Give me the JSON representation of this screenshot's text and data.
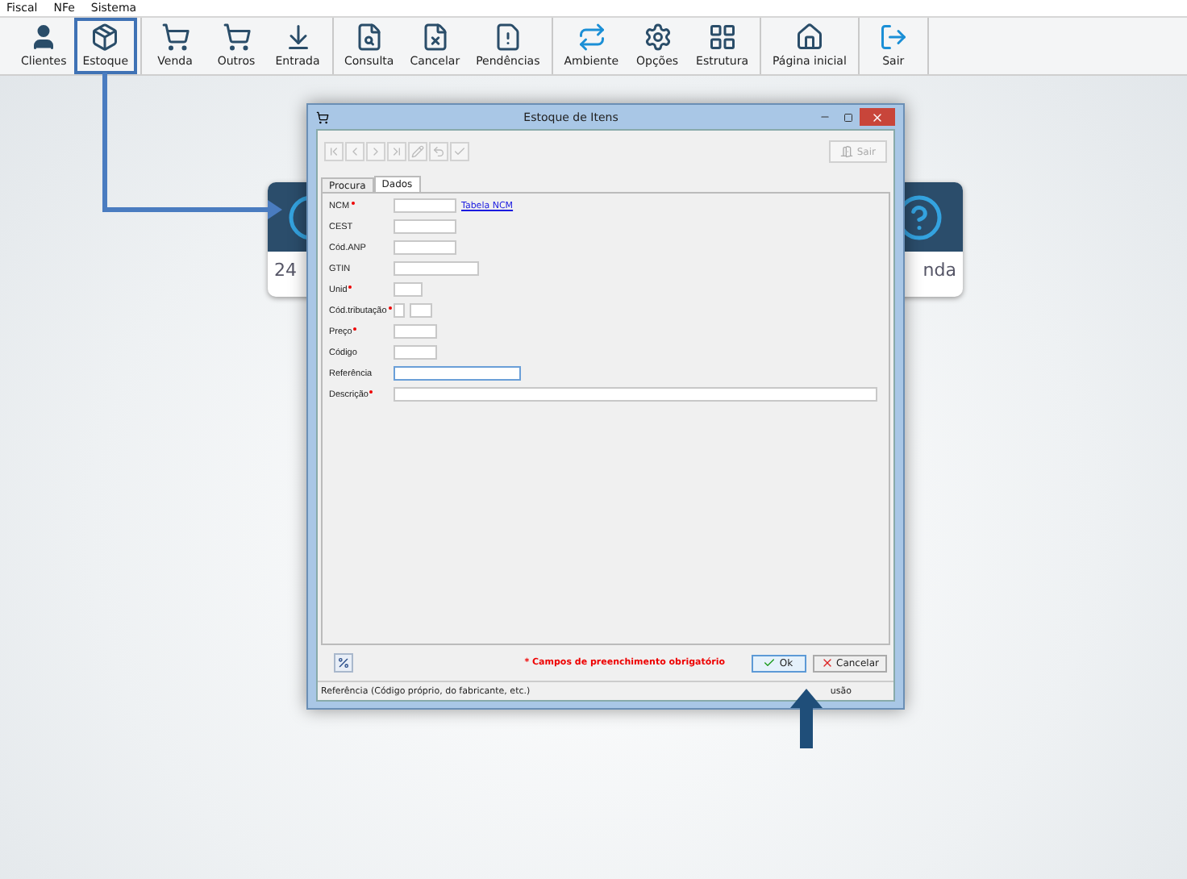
{
  "menu": [
    "Fiscal",
    "NFe",
    "Sistema"
  ],
  "toolbar": [
    {
      "items": [
        {
          "kind": "person",
          "label": "Clientes",
          "highlighted": false
        },
        {
          "kind": "box",
          "label": "Estoque",
          "highlighted": true
        }
      ]
    },
    {
      "items": [
        {
          "kind": "cart-plus",
          "label": "Venda",
          "highlighted": false
        },
        {
          "kind": "cart",
          "label": "Outros",
          "highlighted": false
        },
        {
          "kind": "download",
          "label": "Entrada",
          "highlighted": false
        }
      ]
    },
    {
      "items": [
        {
          "kind": "doc-search",
          "label": "Consulta",
          "highlighted": false
        },
        {
          "kind": "doc-x",
          "label": "Cancelar",
          "highlighted": false
        },
        {
          "kind": "doc-warn",
          "label": "Pendências",
          "highlighted": false
        }
      ]
    },
    {
      "items": [
        {
          "kind": "repeat",
          "label": "Ambiente",
          "highlighted": false
        },
        {
          "kind": "gears",
          "label": "Opções",
          "highlighted": false
        },
        {
          "kind": "grid",
          "label": "Estrutura",
          "highlighted": false
        }
      ]
    },
    {
      "items": [
        {
          "kind": "home",
          "label": "Página inicial",
          "highlighted": false
        }
      ]
    },
    {
      "items": [
        {
          "kind": "exit",
          "label": "Sair",
          "highlighted": false
        }
      ]
    }
  ],
  "background_cards": [
    {
      "text": "24"
    },
    {
      "text": "nda"
    }
  ],
  "dialog": {
    "title": "Estoque de Itens",
    "nav_buttons": [
      {
        "kind": "first",
        "disabled": true
      },
      {
        "kind": "prev",
        "disabled": true
      },
      {
        "kind": "next",
        "disabled": true
      },
      {
        "kind": "last",
        "disabled": true
      },
      {
        "kind": "edit",
        "disabled": true
      },
      {
        "kind": "undo",
        "disabled": true
      },
      {
        "kind": "check",
        "disabled": true
      }
    ],
    "exit_button": {
      "label": "Sair",
      "disabled": true
    },
    "tabs": [
      {
        "label": "Procura",
        "selected": false
      },
      {
        "label": "Dados",
        "selected": true
      }
    ],
    "fields": [
      {
        "label": "NCM",
        "required": true,
        "kind": "medium",
        "focused": false,
        "link": "Tabela NCM"
      },
      {
        "label": "CEST",
        "required": false,
        "kind": "medium",
        "focused": false
      },
      {
        "label": "Cód.ANP",
        "required": false,
        "kind": "medium",
        "focused": false
      },
      {
        "label": "GTIN",
        "required": false,
        "kind": "long",
        "focused": false
      },
      {
        "label": "Unid",
        "required": true,
        "kind": "tiny",
        "focused": false
      },
      {
        "label": "Cód.tributação",
        "required": true,
        "kind": "pair",
        "focused": false
      },
      {
        "label": "Preço",
        "required": true,
        "kind": "short",
        "focused": false
      },
      {
        "label": "Código",
        "required": false,
        "kind": "short",
        "focused": false
      },
      {
        "label": "Referência",
        "required": false,
        "kind": "wide",
        "focused": true
      },
      {
        "label": "Descrição",
        "required": true,
        "kind": "full",
        "focused": false
      }
    ],
    "required_note": "* Campos de preenchimento obrigatório",
    "ok_button": {
      "label": "Ok",
      "default": true
    },
    "cancel_button": {
      "label": "Cancelar"
    },
    "status_text": "Referência (Código próprio, do fabricante, etc.)",
    "status_right": "usão"
  }
}
